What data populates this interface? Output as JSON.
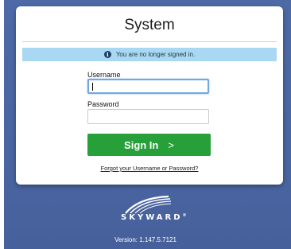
{
  "title": "System",
  "notice": {
    "icon": "info-icon",
    "glyph": "i",
    "text": "You are no longer signed in."
  },
  "form": {
    "username_label": "Username",
    "username_value": "",
    "password_label": "Password",
    "password_value": "",
    "signin_label": "Sign In",
    "signin_chevron": ">",
    "forgot_link": "Forgot your Username or Password?"
  },
  "logo": {
    "brand": "SKYWARD",
    "mark": "®"
  },
  "footer": {
    "version": "Version: 1.147.5.7121"
  },
  "colors": {
    "background": "#4a66a2",
    "notice_bg": "#a8d8f2",
    "signin_bg": "#27a03a",
    "focus_border": "#74a7e2"
  }
}
